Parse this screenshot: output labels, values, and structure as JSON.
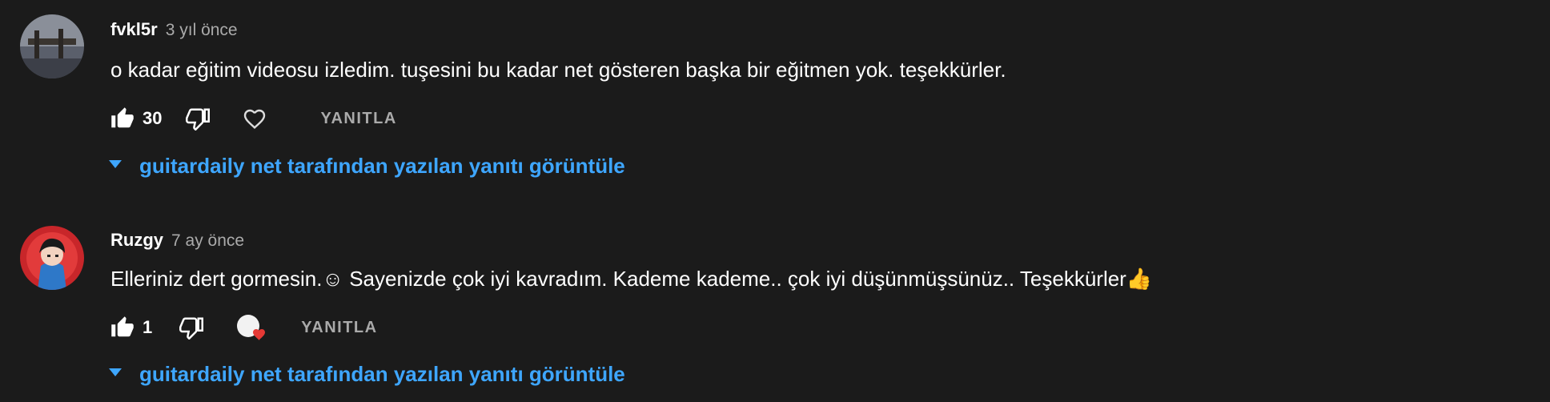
{
  "comments": [
    {
      "author": "fvkl5r",
      "time": "3 yıl önce",
      "text": "o kadar eğitim videosu izledim. tuşesini bu kadar net gösteren başka bir eğitmen yok. teşekkürler.",
      "likes": "30",
      "reply_label": "YANITLA",
      "view_replies": "guitardaily net tarafından yazılan yanıtı görüntüle",
      "creator_hearted": false
    },
    {
      "author": "Ruzgy",
      "time": "7 ay önce",
      "text": "Elleriniz dert gormesin.☺ Sayenizde çok iyi kavradım. Kademe kademe.. çok iyi düşünmüşsünüz.. Teşekkürler👍",
      "likes": "1",
      "reply_label": "YANITLA",
      "view_replies": "guitardaily net tarafından yazılan yanıtı görüntüle",
      "creator_hearted": true
    }
  ],
  "colors": {
    "background": "#1b1b1b",
    "link": "#3ea6ff",
    "secondary_text": "#aaaaaa",
    "heart": "#e53935"
  }
}
